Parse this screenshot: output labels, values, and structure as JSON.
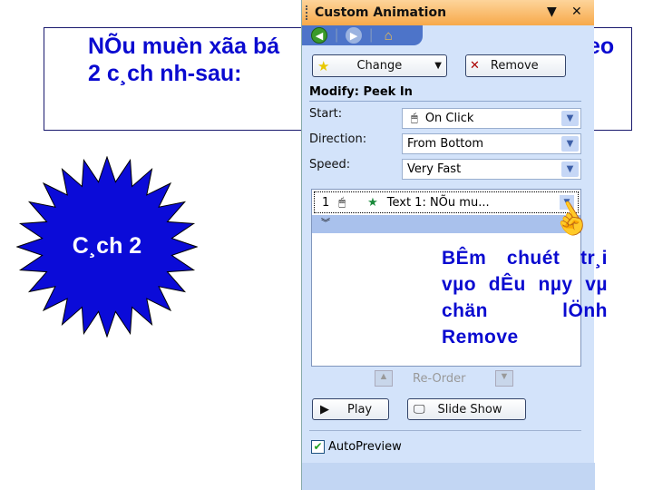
{
  "slide": {
    "title_line1_left": "NÕu muèn xãa bá",
    "title_line1_right": "eo",
    "title_line2": "2 c¸ch nh­-sau:",
    "burst_label": "C¸ch 2",
    "callout": "BÊm chuét tr¸i vµo dÊu nµy vµ chän lÖnh Remove",
    "text_color": "#0a0ad0",
    "burst_color": "#0b0bd8"
  },
  "panel": {
    "title": "Custom Animation",
    "change_label": "Change",
    "remove_label": "Remove",
    "modify_heading": "Modify: Peek In",
    "start_label": "Start:",
    "start_value": "On Click",
    "direction_label": "Direction:",
    "direction_value": "From Bottom",
    "speed_label": "Speed:",
    "speed_value": "Very Fast",
    "items": [
      {
        "number": "1",
        "text": "Text 1: NÕu mu..."
      }
    ],
    "reorder_label": "Re-Order",
    "play_label": "Play",
    "slideshow_label": "Slide Show",
    "autopreview_label": "AutoPreview",
    "autopreview_checked": true
  }
}
